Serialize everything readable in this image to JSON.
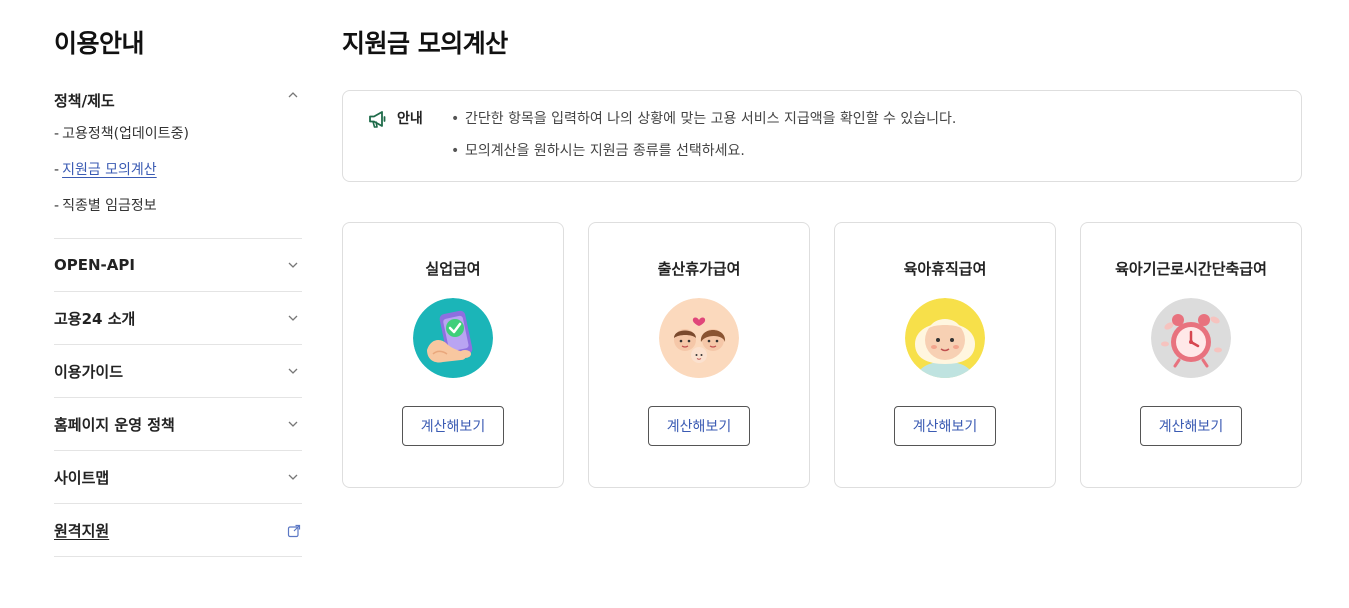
{
  "sidebar": {
    "title": "이용안내",
    "groups": [
      {
        "label": "정책/제도",
        "expanded": true,
        "items": [
          {
            "dash": "-",
            "label": "고용정책(업데이트중)"
          },
          {
            "dash": "-",
            "label": "지원금 모의계산",
            "active": true
          },
          {
            "dash": "-",
            "label": "직종별 임금정보"
          }
        ]
      },
      {
        "label": "OPEN-API"
      },
      {
        "label": "고용24 소개"
      },
      {
        "label": "이용가이드"
      },
      {
        "label": "홈페이지 운영 정책"
      },
      {
        "label": "사이트맵"
      },
      {
        "label": "원격지원",
        "icon": "external-link-icon"
      }
    ]
  },
  "main": {
    "title": "지원금 모의계산",
    "notice": {
      "label": "안내",
      "icon": "megaphone-icon",
      "lines": [
        "간단한 항목을 입력하여 나의 상황에 맞는 고용 서비스 지급액을 확인할 수 있습니다.",
        "모의계산을 원하시는 지원금 종류를 선택하세요."
      ]
    },
    "cards": [
      {
        "title": "실업급여",
        "button": "계산해보기",
        "icon": "phone-check-illustration"
      },
      {
        "title": "출산휴가급여",
        "button": "계산해보기",
        "icon": "parents-baby-illustration"
      },
      {
        "title": "육아휴직급여",
        "button": "계산해보기",
        "icon": "baby-face-illustration"
      },
      {
        "title": "육아기근로시간단축급여",
        "button": "계산해보기",
        "icon": "alarm-clock-illustration"
      }
    ]
  },
  "colors": {
    "accent_link": "#3b5bb3",
    "notice_icon": "#1f6b4a",
    "border": "#dedede"
  }
}
